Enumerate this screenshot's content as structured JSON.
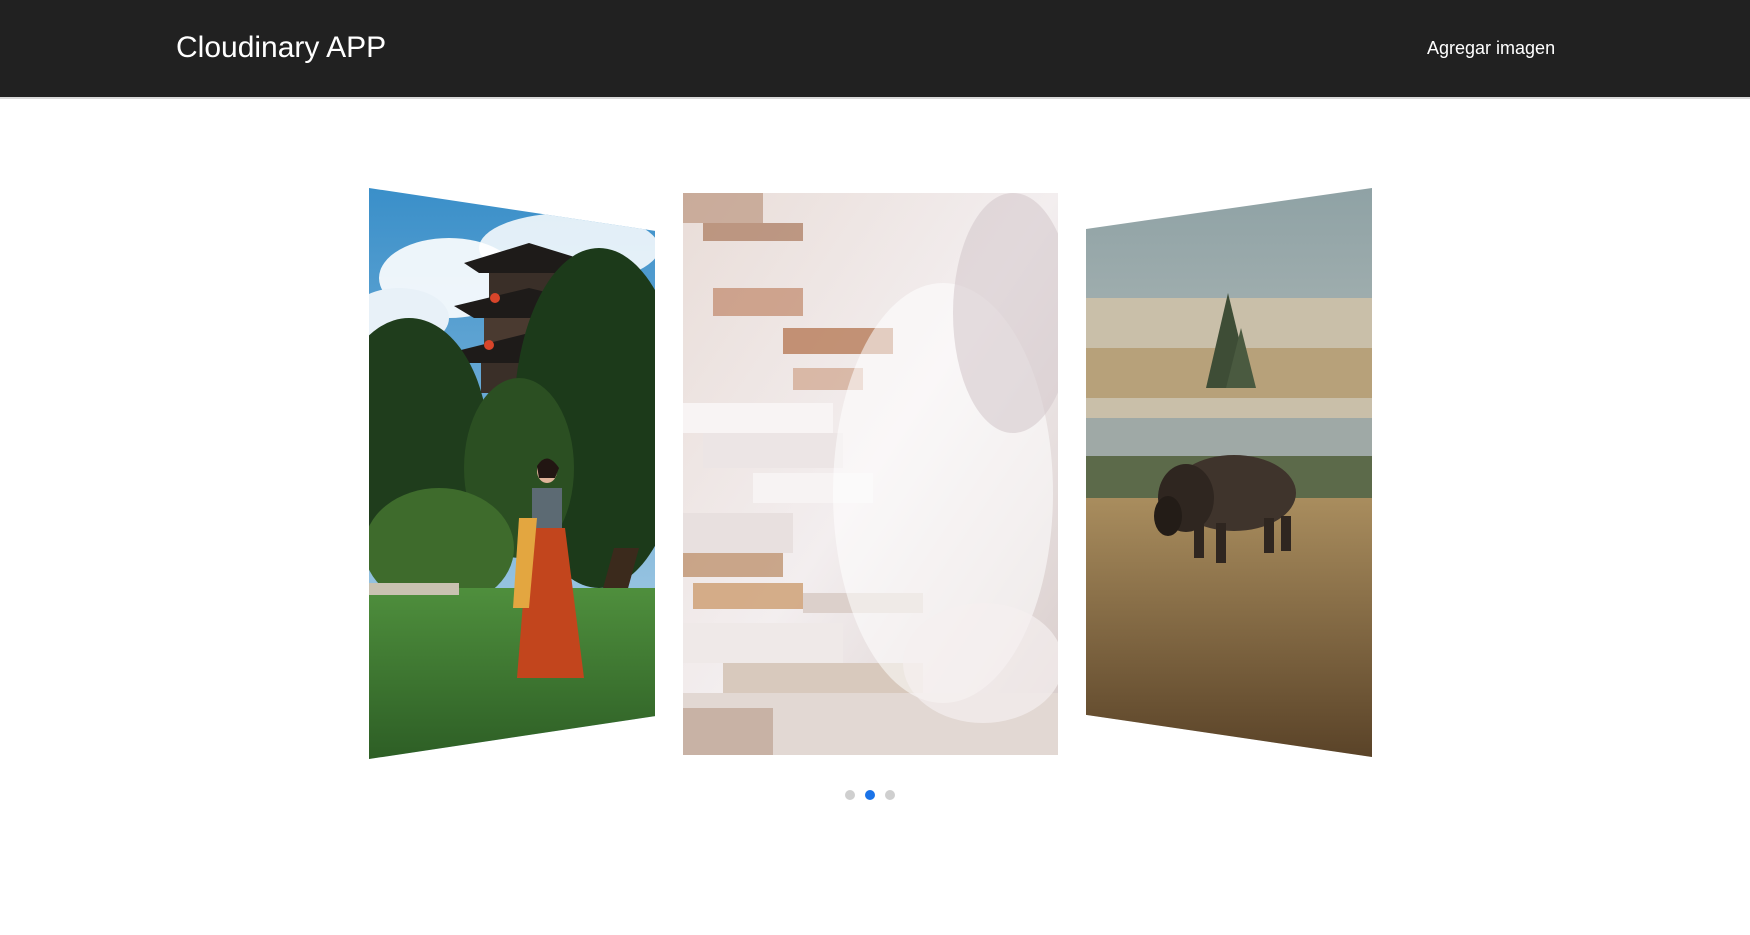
{
  "navbar": {
    "brand": "Cloudinary APP",
    "add_image_link": "Agregar imagen"
  },
  "carousel": {
    "slides": [
      {
        "subject": "woman in red dress beside pagoda and trees",
        "position": "left"
      },
      {
        "subject": "white travertine terraces with steam",
        "position": "center"
      },
      {
        "subject": "bison grazing in misty meadow",
        "position": "right"
      }
    ],
    "active_index": 1,
    "dots": 3
  },
  "colors": {
    "navbar_bg": "#212121",
    "dot_active": "#1a73e8",
    "dot_inactive": "#cfcfcf"
  }
}
